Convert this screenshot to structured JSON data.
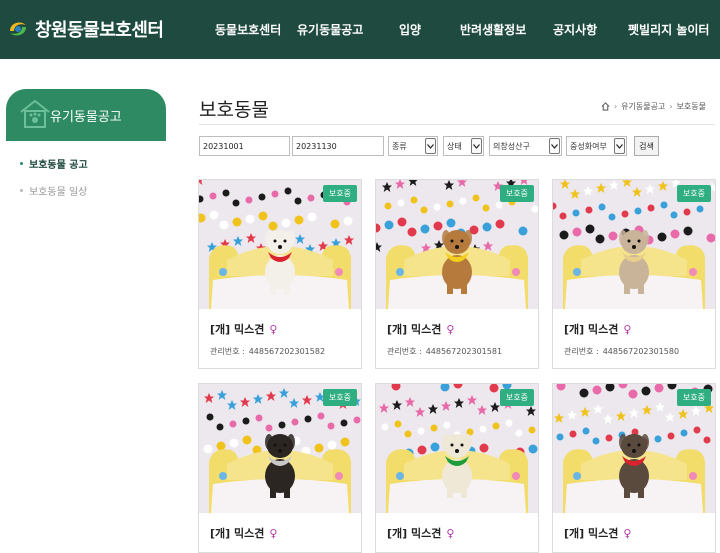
{
  "header": {
    "logo_text": "창원동물보호센터",
    "nav": [
      "동물보호센터",
      "유기동물공고",
      "입양",
      "반려생활정보",
      "공지사항",
      "펫빌리지 놀이터"
    ]
  },
  "sidebar": {
    "title": "유기동물공고",
    "items": [
      {
        "label": "보호동물 공고"
      },
      {
        "label": "보호동물 일상"
      }
    ]
  },
  "main": {
    "title": "보호동물",
    "breadcrumb": [
      "유기동물공고",
      "보호동물"
    ]
  },
  "filters": {
    "start_date": "20231001",
    "end_date": "20231130",
    "type_select": "종류",
    "status_select": "상태",
    "district_select": "의창성산구",
    "neuter_select": "중성화여부",
    "search_button": "검색"
  },
  "cards": [
    {
      "badge": "보호중",
      "title": "[개] 믹스견",
      "sex_icon": "female-icon",
      "id_label": "관리번호 :",
      "id": "448567202301582",
      "dog_color": "#f3f0ea",
      "scarf": "#d9232e"
    },
    {
      "badge": "보호중",
      "title": "[개] 믹스견",
      "sex_icon": "female-icon",
      "id_label": "관리번호 :",
      "id": "448567202301581",
      "dog_color": "#b57a3c",
      "scarf": "#f2cf1d"
    },
    {
      "badge": "보호중",
      "title": "[개] 믹스견",
      "sex_icon": "female-icon",
      "id_label": "관리번호 :",
      "id": "448567202301580",
      "dog_color": "#c9b49a",
      "scarf": "#e8d08a"
    },
    {
      "badge": "보호중",
      "title": "[개] 믹스견",
      "sex_icon": "female-icon",
      "id_label": "",
      "id": "",
      "dog_color": "#2b2622",
      "scarf": "#c8c8c8"
    },
    {
      "badge": "보호중",
      "title": "[개] 믹스견",
      "sex_icon": "female-icon",
      "id_label": "",
      "id": "",
      "dog_color": "#efe8d6",
      "scarf": "#1e9c3c"
    },
    {
      "badge": "보호중",
      "title": "[개] 믹스견",
      "sex_icon": "female-icon",
      "id_label": "",
      "id": "",
      "dog_color": "#5a4a3e",
      "scarf": "#d9232e"
    }
  ],
  "colors": {
    "header_bg": "#1e4a3f",
    "accent": "#2d8a63",
    "badge": "#2fae82",
    "female": "#b03aa6"
  }
}
